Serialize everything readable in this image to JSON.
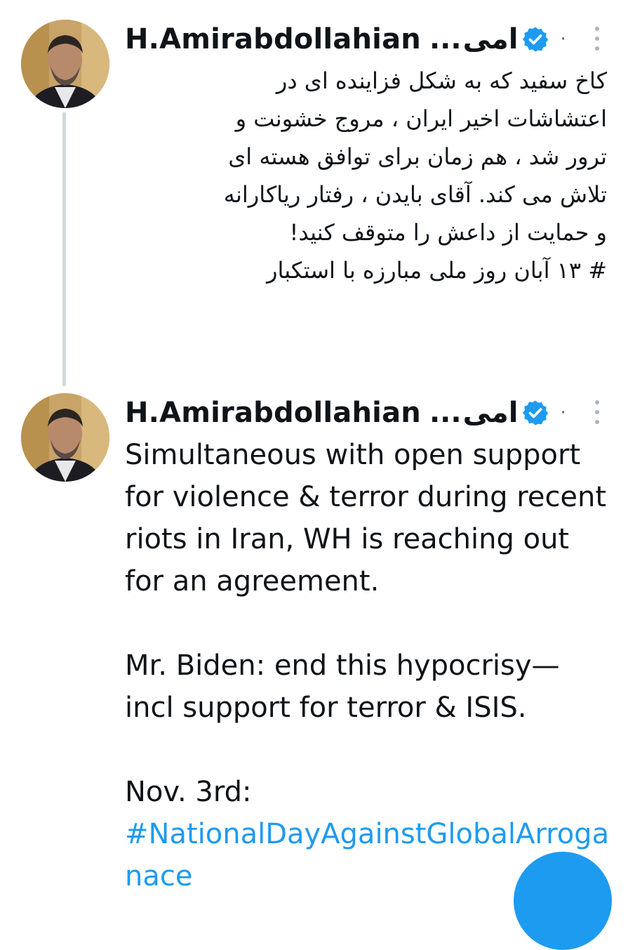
{
  "tweets": [
    {
      "display_name": "H.Amirabdollahian",
      "name_ellipsis": "...",
      "name_rtl": "امی",
      "separator": "·",
      "text_lines": [
        "کاخ سفید که به شکل فزاینده ای در",
        "اعتشاشات اخیر ایران ، مروج خشونت و",
        "ترور شد ، هم زمان برای توافق هسته ای",
        "تلاش می کند. آقای بایدن ، رفتار ریاکارانه",
        "و حمایت از داعش را متوقف کنید!",
        "# ۱۳ آبان روز ملی مبارزه با استکبار"
      ]
    },
    {
      "display_name": "H.Amirabdollahian",
      "name_ellipsis": "...",
      "name_rtl": "امی",
      "separator": "·",
      "text_lines": [
        "Simultaneous with open support",
        "for violence & terror during recent",
        "riots in Iran, WH is reaching out",
        "for an agreement.",
        "",
        "Mr. Biden: end this hypocrisy—",
        "incl support for terror & ISIS.",
        "",
        "Nov. 3rd:"
      ],
      "hashtag_lines": [
        "#NationalDayAgainstGlobalArroga",
        "nace"
      ]
    }
  ],
  "icons": {
    "verified": "verified-badge-icon",
    "more": "more-vertical-icon",
    "fab": "compose-fab"
  },
  "colors": {
    "accent": "#1d9bf0",
    "text": "#0f1419",
    "muted": "#536471",
    "thread_line": "#cfd9de"
  }
}
